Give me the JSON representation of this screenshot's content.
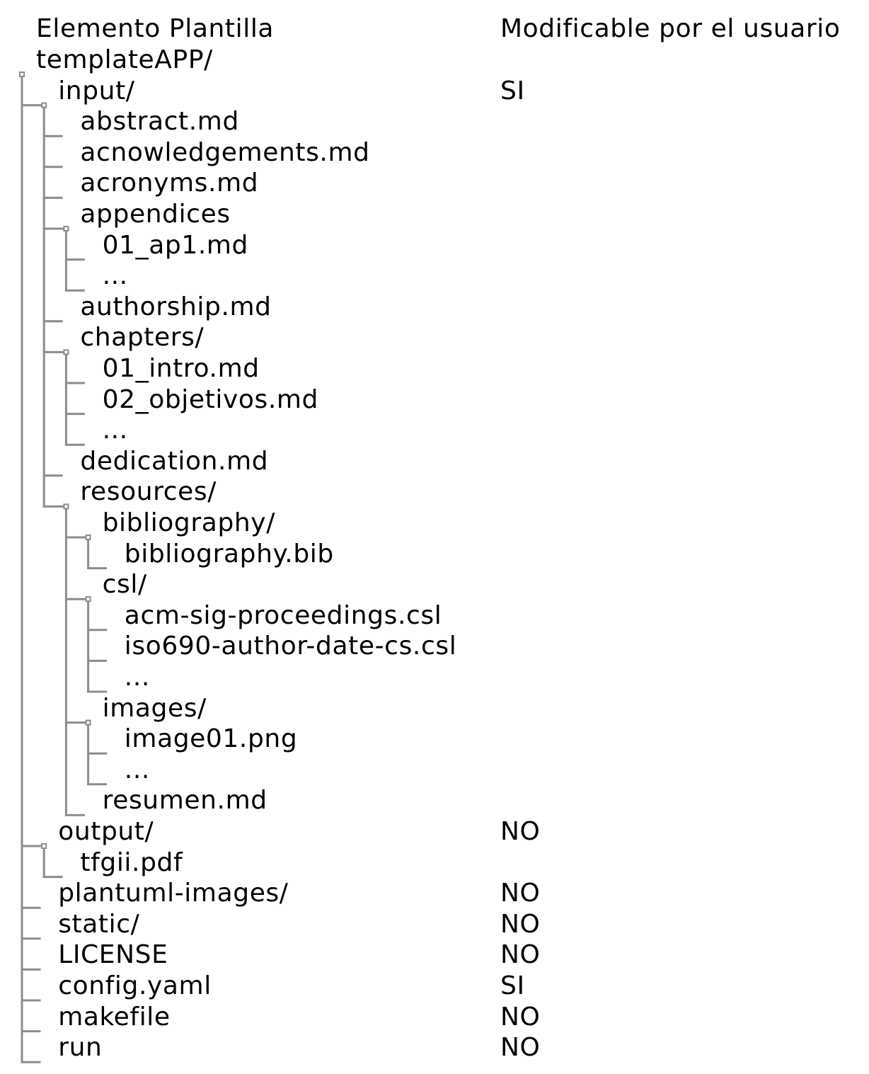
{
  "headers": {
    "element": "Elemento Plantilla",
    "modifiable": "Modificable por el usuario"
  },
  "tree": [
    {
      "label": "templateAPP/",
      "depth": 0,
      "folder": true
    },
    {
      "label": "input/",
      "depth": 1,
      "folder": true,
      "modifiable": "SI"
    },
    {
      "label": "abstract.md",
      "depth": 2
    },
    {
      "label": "acnowledgements.md",
      "depth": 2
    },
    {
      "label": "acronyms.md",
      "depth": 2
    },
    {
      "label": "appendices",
      "depth": 2,
      "folder": true
    },
    {
      "label": "01_ap1.md",
      "depth": 3
    },
    {
      "label": "...",
      "depth": 3
    },
    {
      "label": "authorship.md",
      "depth": 2
    },
    {
      "label": "chapters/",
      "depth": 2,
      "folder": true
    },
    {
      "label": "01_intro.md",
      "depth": 3
    },
    {
      "label": "02_objetivos.md",
      "depth": 3
    },
    {
      "label": "...",
      "depth": 3
    },
    {
      "label": "dedication.md",
      "depth": 2
    },
    {
      "label": "resources/",
      "depth": 2,
      "folder": true
    },
    {
      "label": "bibliography/",
      "depth": 3,
      "folder": true
    },
    {
      "label": "bibliography.bib",
      "depth": 4
    },
    {
      "label": "csl/",
      "depth": 3,
      "folder": true
    },
    {
      "label": "acm-sig-proceedings.csl",
      "depth": 4
    },
    {
      "label": "iso690-author-date-cs.csl",
      "depth": 4
    },
    {
      "label": "...",
      "depth": 4
    },
    {
      "label": "images/",
      "depth": 3,
      "folder": true
    },
    {
      "label": "image01.png",
      "depth": 4
    },
    {
      "label": "...",
      "depth": 4
    },
    {
      "label": "resumen.md",
      "depth": 3
    },
    {
      "label": "output/",
      "depth": 1,
      "folder": true,
      "modifiable": "NO"
    },
    {
      "label": "tfgii.pdf",
      "depth": 2
    },
    {
      "label": "plantuml-images/",
      "depth": 1,
      "modifiable": "NO"
    },
    {
      "label": "static/",
      "depth": 1,
      "modifiable": "NO"
    },
    {
      "label": "LICENSE",
      "depth": 1,
      "modifiable": "NO"
    },
    {
      "label": "config.yaml",
      "depth": 1,
      "modifiable": "SI"
    },
    {
      "label": "makefile",
      "depth": 1,
      "modifiable": "NO"
    },
    {
      "label": "run",
      "depth": 1,
      "modifiable": "NO"
    }
  ]
}
